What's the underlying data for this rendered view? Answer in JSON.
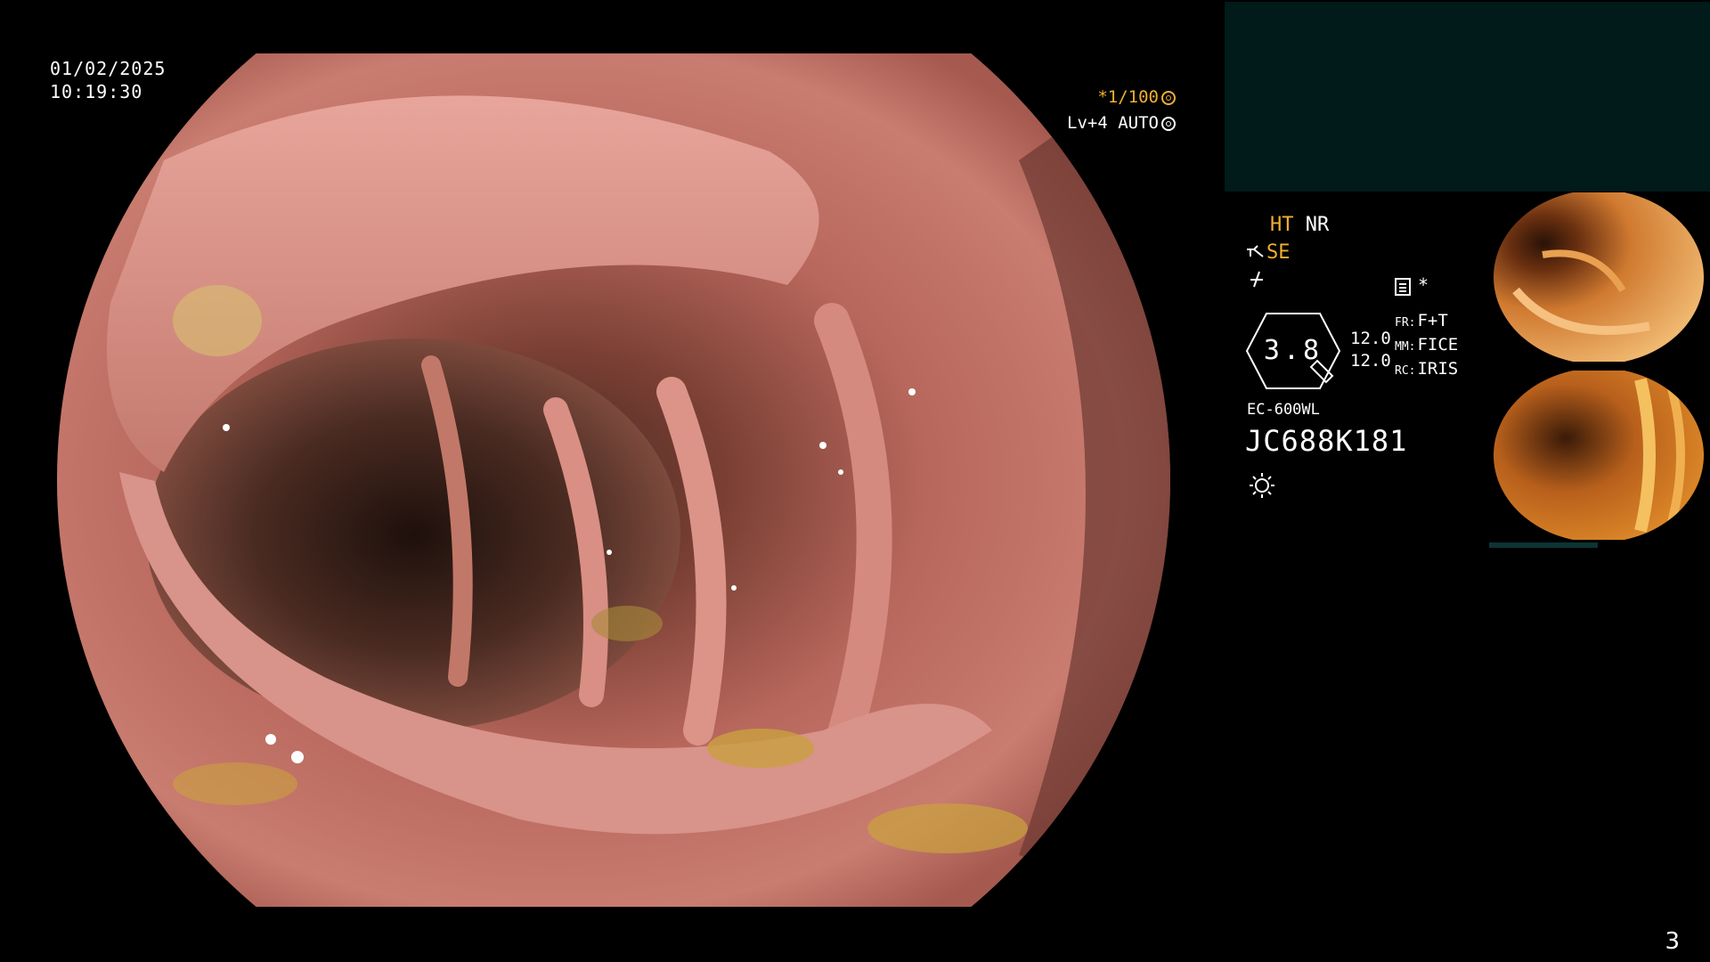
{
  "overlay": {
    "date": "01/02/2025",
    "time": "10:19:30",
    "shutter": "*1/100",
    "shutter_icon": "aperture-icon",
    "level": "Lv+4 AUTO",
    "level_icon": "iris-icon"
  },
  "settings": {
    "ht_label": "HT",
    "nr_label": "NR",
    "se_label": "SE",
    "se_icon": "structure-enhancement-icon",
    "freeze_icon": "freeze-icon",
    "memory_icon": "memory-icon",
    "memory_marker": "*",
    "zoom_value": "3.8",
    "values": [
      "12.0",
      "12.0"
    ],
    "fr_key": "FR:",
    "fr_value": "F+T",
    "mm_key": "MM:",
    "mm_value": "FICE",
    "rc_key": "RC:",
    "rc_value": "IRIS",
    "scope_model": "EC-600WL",
    "scope_serial": "JC688K181",
    "light_icon": "light-source-icon"
  },
  "page_number": "3",
  "colors": {
    "accent_orange": "#f0b030",
    "panel_teal": "#011a1a"
  }
}
